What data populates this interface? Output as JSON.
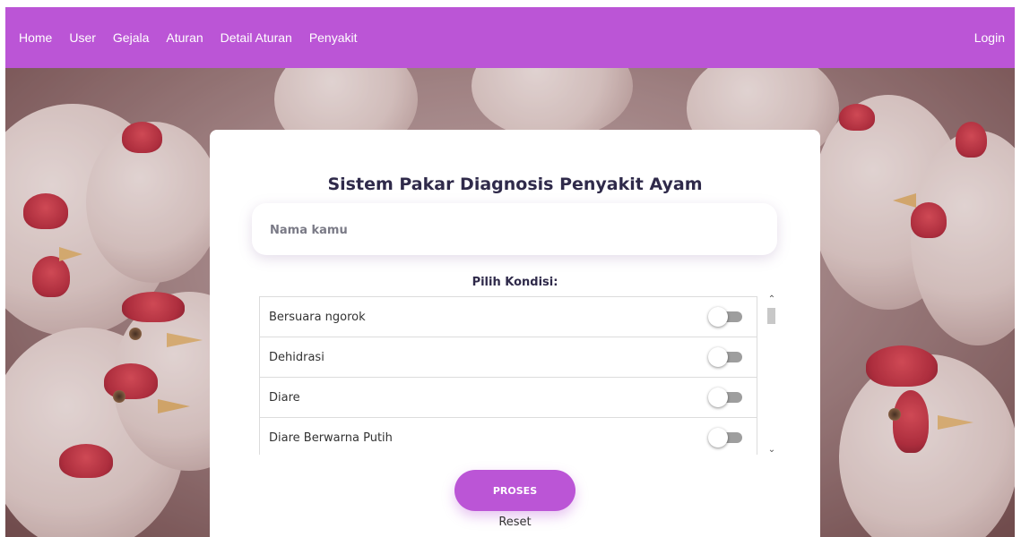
{
  "nav": {
    "items": [
      "Home",
      "User",
      "Gejala",
      "Aturan",
      "Detail Aturan",
      "Penyakit"
    ],
    "login": "Login"
  },
  "card": {
    "title": "Sistem Pakar Diagnosis Penyakit Ayam",
    "name_placeholder": "Nama kamu",
    "pilih_label": "Pilih Kondisi:",
    "conditions": [
      "Bersuara ngorok",
      "Dehidrasi",
      "Diare",
      "Diare Berwarna Putih"
    ],
    "proses_label": "PROSES",
    "reset_label": "Reset"
  },
  "colors": {
    "accent": "#bb55d6",
    "title_text": "#2f2a4a"
  },
  "icons": {
    "scroll_up": "chevron-up-icon",
    "scroll_down": "chevron-down-icon"
  }
}
